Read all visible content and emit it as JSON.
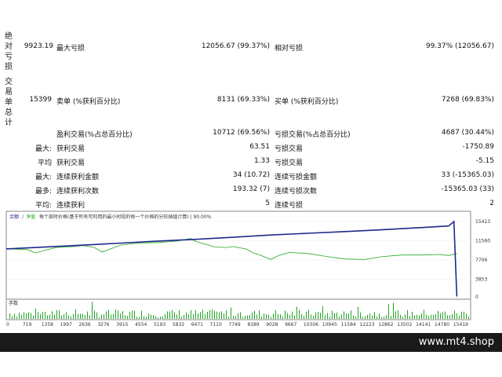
{
  "side_labels": {
    "absolute_loss": "绝对亏损",
    "total_trades": "交易单总计"
  },
  "stats": {
    "row1": {
      "v1": "9923.19",
      "l2": "最大亏损",
      "v2": "12056.67 (99.37%)",
      "l3": "相对亏损",
      "v3": "99.37% (12056.67)"
    },
    "row2": {
      "v1": "15399",
      "l2": "卖单 (%获利百分比)",
      "v2": "8131 (69.33%)",
      "l3": "买单 (%获利百分比)",
      "v3": "7268 (69.83%)"
    },
    "row3": {
      "l2": "盈利交易(%占总百分比)",
      "v2": "10712 (69.56%)",
      "l3": "亏损交易(%占总百分比)",
      "v3": "4687 (30.44%)"
    },
    "row4": {
      "p": "最大:",
      "l2": "获利交易",
      "v2": "63.51",
      "l3": "亏损交易",
      "v3": "-1750.89"
    },
    "row5": {
      "p": "平均",
      "l2": "获利交易",
      "v2": "1.33",
      "l3": "亏损交易",
      "v3": "-5.15"
    },
    "row6": {
      "p": "最大:",
      "l2": "连续获利金额",
      "v2": "34 (10.72)",
      "l3": "连续亏损金额",
      "v3": "33 (-15365.03)"
    },
    "row7": {
      "p": "最多:",
      "l2": "连续获利次数",
      "v2": "193.32 (7)",
      "l3": "连续亏损次数",
      "v3": "-15365.03 (33)"
    },
    "row8": {
      "p": "平均:",
      "l2": "连续获利",
      "v2": "5",
      "l3": "连续亏损",
      "v3": "2"
    }
  },
  "chart": {
    "legend_balance": "余额",
    "legend_equity": "净值",
    "legend_text": "每个部时价格(基于所有可利用的最小时段的每一个价格的分形插值计算) | 90.00%",
    "volume_label": "手数"
  },
  "chart_data": {
    "type": "line",
    "series": [
      {
        "name": "余额",
        "color": "#1c2a8a",
        "x": [
          0,
          1358,
          2636,
          3915,
          5193,
          6471,
          7749,
          9028,
          10306,
          11584,
          12862,
          14141,
          15100,
          15280,
          15380
        ],
        "y": [
          9923,
          10320,
          10680,
          11090,
          11490,
          11850,
          12250,
          12700,
          13050,
          13400,
          13780,
          14180,
          14520,
          15413,
          400
        ]
      },
      {
        "name": "净值",
        "color": "#22a622",
        "x": [
          0,
          719,
          1000,
          1358,
          1700,
          2100,
          2636,
          3000,
          3276,
          3500,
          3915,
          4554,
          5193,
          5832,
          6300,
          6471,
          6900,
          7110,
          7500,
          7749,
          8200,
          8389,
          8700,
          9028,
          9300,
          9667,
          10306,
          10945,
          11584,
          12223,
          12862,
          13502,
          14141,
          14780,
          15100,
          15380
        ],
        "y": [
          9923,
          9800,
          9100,
          9700,
          10200,
          10300,
          10600,
          10200,
          9300,
          9800,
          10700,
          11100,
          11200,
          11500,
          12000,
          11400,
          10700,
          10300,
          10200,
          10400,
          9900,
          9200,
          8600,
          7800,
          8600,
          9200,
          9000,
          8400,
          7900,
          7800,
          8400,
          8700,
          8700,
          8800,
          8600,
          9000
        ]
      }
    ],
    "x_ticks": [
      "0",
      "719",
      "1358",
      "1997",
      "2636",
      "3276",
      "3915",
      "4554",
      "5193",
      "5832",
      "6471",
      "7110",
      "7749",
      "8389",
      "9028",
      "9667",
      "10306",
      "10945",
      "11584",
      "12223",
      "12862",
      "13502",
      "14141",
      "14780",
      "15419"
    ],
    "y_ticks": [
      "15413",
      "11560",
      "7706",
      "3853",
      "0"
    ],
    "xlim": [
      0,
      15850
    ],
    "ylim": [
      0,
      15413
    ],
    "volume_note": "lots histogram at bottom"
  },
  "brand": "www.mt4.shop",
  "colors": {
    "balance": "#1c2a8a",
    "equity": "#22a622",
    "bottom_bar": "#1a1a1a"
  }
}
